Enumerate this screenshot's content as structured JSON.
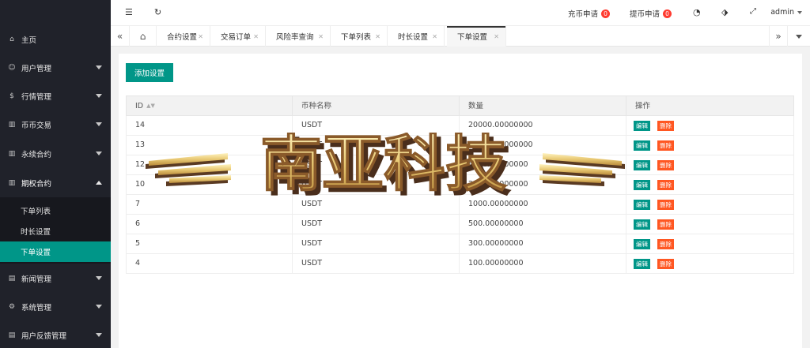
{
  "sidebar": {
    "items": [
      {
        "label": "主页",
        "icon": "home-icon"
      },
      {
        "label": "用户管理",
        "icon": "user-icon"
      },
      {
        "label": "行情管理",
        "icon": "dollar-icon"
      },
      {
        "label": "币币交易",
        "icon": "chart-icon"
      },
      {
        "label": "永续合约",
        "icon": "chart-icon"
      },
      {
        "label": "期权合约",
        "icon": "chart-icon"
      },
      {
        "label": "新闻管理",
        "icon": "news-icon"
      },
      {
        "label": "系统管理",
        "icon": "gear-icon"
      },
      {
        "label": "用户反馈管理",
        "icon": "feedback-icon"
      }
    ],
    "submenu": [
      {
        "label": "下单列表"
      },
      {
        "label": "时长设置"
      },
      {
        "label": "下单设置"
      }
    ]
  },
  "header": {
    "recharge_label": "充币申请",
    "recharge_count": "0",
    "withdraw_label": "提币申请",
    "withdraw_count": "0",
    "user": "admin"
  },
  "tabs": [
    {
      "label": "合约设置"
    },
    {
      "label": "交易订单"
    },
    {
      "label": "风险率查询"
    },
    {
      "label": "下单列表"
    },
    {
      "label": "时长设置"
    },
    {
      "label": "下单设置"
    }
  ],
  "toolbar": {
    "add_label": "添加设置"
  },
  "table": {
    "columns": [
      "ID",
      "币种名称",
      "数量",
      "操作"
    ],
    "edit_label": "编辑",
    "delete_label": "删除",
    "rows": [
      {
        "id": "14",
        "coin": "USDT",
        "amount": "20000.00000000"
      },
      {
        "id": "13",
        "coin": "USDT",
        "amount": "10000.00000000"
      },
      {
        "id": "12",
        "coin": "USDT",
        "amount": "5000.00000000"
      },
      {
        "id": "10",
        "coin": "USDT",
        "amount": "2000.00000000"
      },
      {
        "id": "7",
        "coin": "USDT",
        "amount": "1000.00000000"
      },
      {
        "id": "6",
        "coin": "USDT",
        "amount": "500.00000000"
      },
      {
        "id": "5",
        "coin": "USDT",
        "amount": "300.00000000"
      },
      {
        "id": "4",
        "coin": "USDT",
        "amount": "100.00000000"
      }
    ]
  },
  "watermark": {
    "text": "南亚科技"
  },
  "colors": {
    "accent": "#009688",
    "danger": "#ff5722",
    "sidebar": "#20222a",
    "badge": "#ff3b30"
  }
}
